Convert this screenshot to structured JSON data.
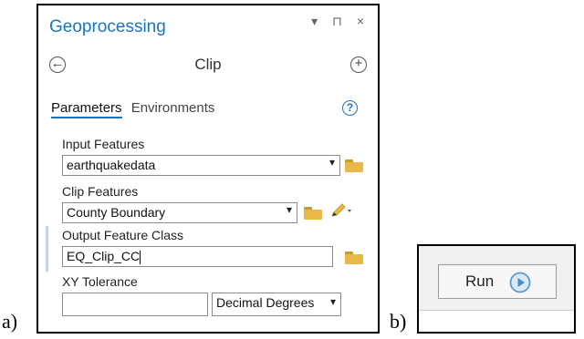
{
  "figure_labels": {
    "a": "a)",
    "b": "b)"
  },
  "panel": {
    "title": "Geoprocessing",
    "window_controls": "▾ ⊓ ×",
    "tool_name": "Clip",
    "tabs": [
      {
        "label": "Parameters"
      },
      {
        "label": "Environments"
      }
    ],
    "help_glyph": "?",
    "back_glyph": "←",
    "add_glyph": "+"
  },
  "params": {
    "input_features": {
      "label": "Input Features",
      "value": "earthquakedata"
    },
    "clip_features": {
      "label": "Clip Features",
      "value": "County Boundary"
    },
    "output_feature_class": {
      "label": "Output Feature Class",
      "value": "EQ_Clip_CC"
    },
    "xy_tolerance": {
      "label": "XY Tolerance",
      "value": "",
      "unit": "Decimal Degrees"
    }
  },
  "run": {
    "label": "Run"
  },
  "dropdown_glyph": "▾",
  "colors": {
    "accent": "#1a73c7",
    "folder": "#e8b84a",
    "run_icon": "#5b9bd5"
  }
}
